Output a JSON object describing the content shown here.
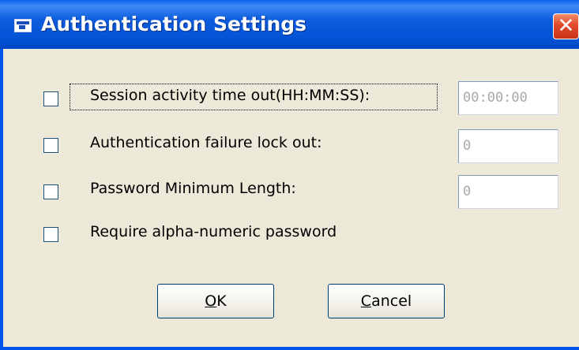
{
  "window": {
    "title": "Authentication Settings",
    "close_glyph": "✕"
  },
  "options": [
    {
      "label": "Session activity time out(HH:MM:SS):",
      "checked": false,
      "value": "00:00:00"
    },
    {
      "label": "Authentication failure lock out:",
      "checked": false,
      "value": "0"
    },
    {
      "label": "Password Minimum Length:",
      "checked": false,
      "value": "0"
    },
    {
      "label": "Require alpha-numeric password",
      "checked": false
    }
  ],
  "buttons": {
    "ok": {
      "mnemonic": "O",
      "rest": "K"
    },
    "cancel": {
      "mnemonic": "C",
      "rest": "ancel"
    }
  },
  "colors": {
    "titlebar": "#0253d6",
    "dialog_bg": "#ece9d8",
    "close_btn": "#e2492a",
    "disabled_text": "#a8a8a8"
  }
}
